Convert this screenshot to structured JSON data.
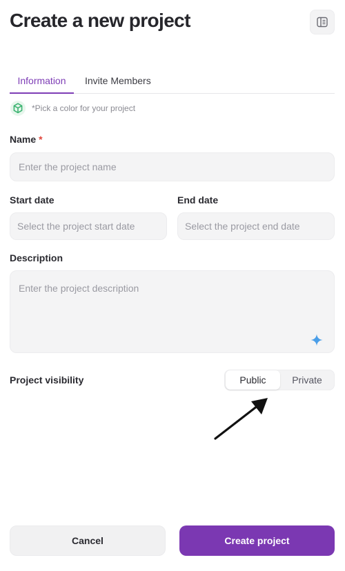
{
  "page": {
    "title": "Create a new project"
  },
  "tabs": [
    {
      "label": "Information",
      "active": true
    },
    {
      "label": "Invite Members",
      "active": false
    }
  ],
  "color_picker": {
    "hint": "*Pick a color for your project",
    "icon": "cube-icon",
    "color": "#3cb371"
  },
  "fields": {
    "name": {
      "label": "Name",
      "required_mark": "*",
      "placeholder": "Enter the project name",
      "value": ""
    },
    "start_date": {
      "label": "Start date",
      "placeholder": "Select the project start date",
      "value": ""
    },
    "end_date": {
      "label": "End date",
      "placeholder": "Select the project end date",
      "value": ""
    },
    "description": {
      "label": "Description",
      "placeholder": "Enter the project description",
      "value": ""
    }
  },
  "visibility": {
    "label": "Project visibility",
    "options": [
      "Public",
      "Private"
    ],
    "selected": "Public"
  },
  "actions": {
    "cancel_label": "Cancel",
    "create_label": "Create project"
  },
  "colors": {
    "accent": "#7b38b2",
    "ai_sparkle": "#4a9ee8"
  }
}
